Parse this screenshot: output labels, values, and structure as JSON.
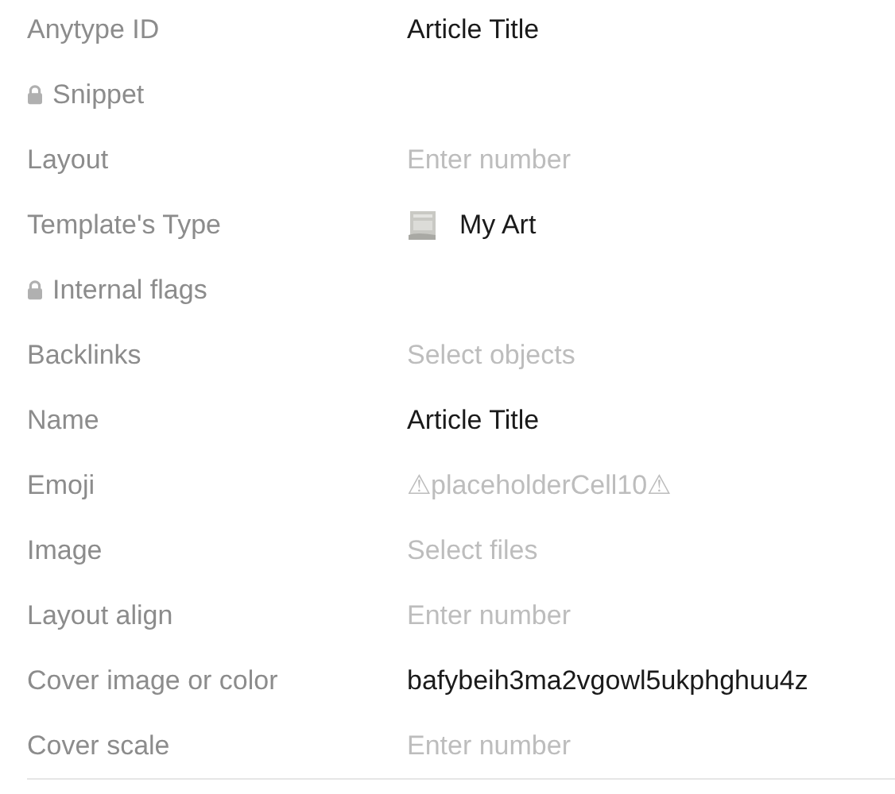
{
  "relations": [
    {
      "label": "Anytype ID",
      "locked": false,
      "value": {
        "kind": "text",
        "text": "Article Title"
      }
    },
    {
      "label": "Snippet",
      "locked": true
    },
    {
      "label": "Layout",
      "locked": false,
      "value": {
        "kind": "placeholder",
        "text": "Enter number"
      }
    },
    {
      "label": "Template's Type",
      "locked": false,
      "value": {
        "kind": "object",
        "text": "My Art"
      }
    },
    {
      "label": "Internal flags",
      "locked": true
    },
    {
      "label": "Backlinks",
      "locked": false,
      "value": {
        "kind": "placeholder",
        "text": "Select objects"
      }
    },
    {
      "label": "Name",
      "locked": false,
      "value": {
        "kind": "text",
        "text": "Article Title"
      }
    },
    {
      "label": "Emoji",
      "locked": false,
      "value": {
        "kind": "placeholder",
        "text": "⚠placeholderCell10⚠"
      }
    },
    {
      "label": "Image",
      "locked": false,
      "value": {
        "kind": "placeholder",
        "text": "Select files"
      }
    },
    {
      "label": "Layout align",
      "locked": false,
      "value": {
        "kind": "placeholder",
        "text": "Enter number"
      }
    },
    {
      "label": "Cover image or color",
      "locked": false,
      "value": {
        "kind": "text",
        "text": "bafybeih3ma2vgowl5ukphghuu4z"
      }
    },
    {
      "label": "Cover scale",
      "locked": false,
      "value": {
        "kind": "placeholder",
        "text": "Enter number"
      }
    }
  ]
}
